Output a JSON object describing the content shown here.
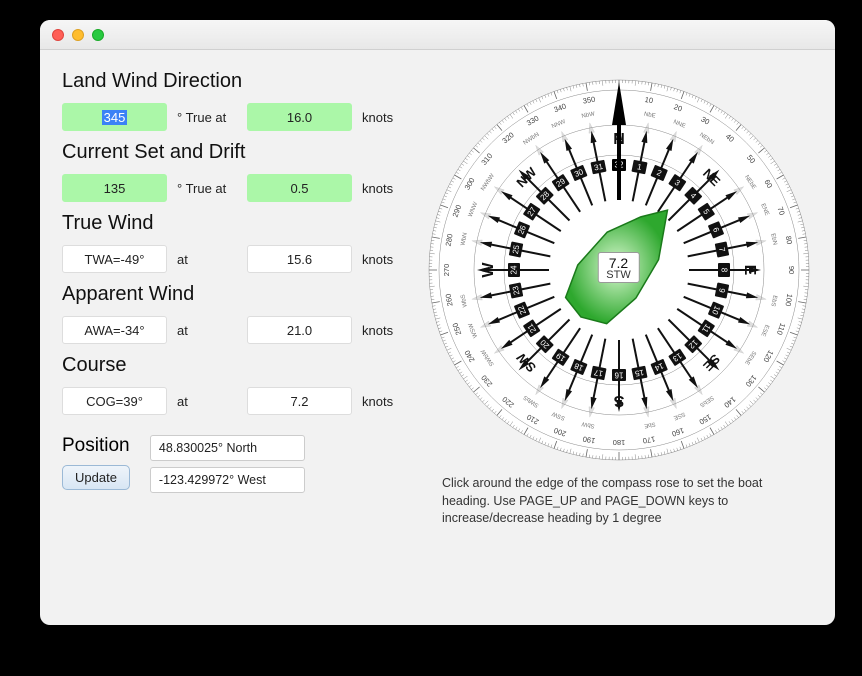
{
  "sections": {
    "landwind": {
      "title": "Land Wind Direction",
      "dir": "345",
      "unit1": "° True at",
      "speed": "16.0",
      "unit2": "knots"
    },
    "current": {
      "title": "Current Set and Drift",
      "dir": "135",
      "unit1": "° True at",
      "speed": "0.5",
      "unit2": "knots"
    },
    "truewind": {
      "title": "True Wind",
      "val1": "TWA=-49°",
      "unit1": "at",
      "val2": "15.6",
      "unit2": "knots"
    },
    "appwind": {
      "title": "Apparent Wind",
      "val1": "AWA=-34°",
      "unit1": "at",
      "val2": "21.0",
      "unit2": "knots"
    },
    "course": {
      "title": "Course",
      "val1": "COG=39°",
      "unit1": "at",
      "val2": "7.2",
      "unit2": "knots"
    }
  },
  "position": {
    "title": "Position",
    "update": "Update",
    "lat": "48.830025° North",
    "lon": "-123.429972° West"
  },
  "compass": {
    "stw_value": "7.2",
    "stw_label": "STW",
    "cardinal": {
      "N": "N",
      "NE": "NE",
      "E": "E",
      "SE": "SE",
      "S": "S",
      "SW": "SW",
      "W": "W",
      "NW": "NW"
    },
    "help": "Click around the edge of the compass rose to set the boat heading. Use PAGE_UP and PAGE_DOWN keys to increase/decrease heading by 1 degree"
  }
}
